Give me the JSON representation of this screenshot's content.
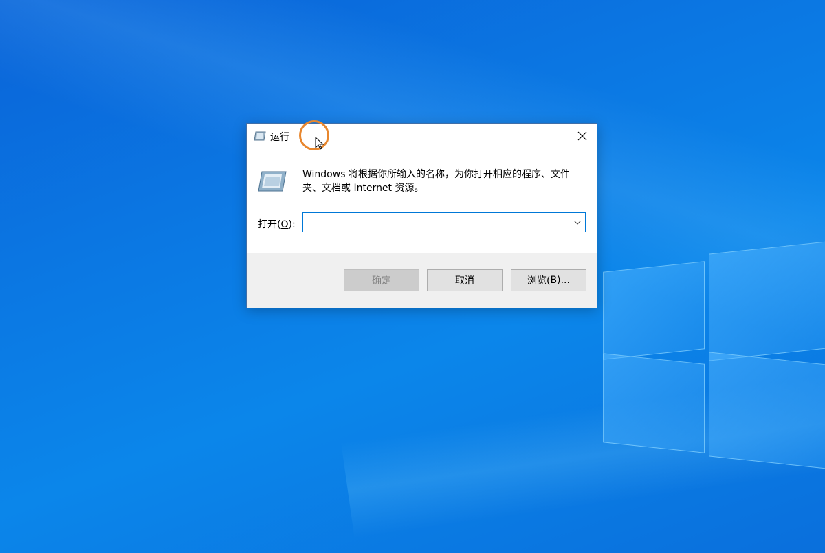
{
  "dialog": {
    "title": "运行",
    "description": "Windows 将根据你所输入的名称，为你打开相应的程序、文件夹、文档或 Internet 资源。",
    "open_label_prefix": "打开(",
    "open_label_hotkey": "O",
    "open_label_suffix": "):",
    "input_value": "",
    "buttons": {
      "ok": "确定",
      "cancel": "取消",
      "browse_prefix": "浏览(",
      "browse_hotkey": "B",
      "browse_suffix": ")..."
    }
  },
  "icons": {
    "title": "run-icon",
    "large": "run-icon",
    "close": "close-icon",
    "dropdown": "chevron-down-icon",
    "pointer": "mouse-pointer-icon"
  },
  "colors": {
    "desktop": "#0b78e3",
    "accent": "#0078d7",
    "cursor_ring": "#e8872e"
  }
}
